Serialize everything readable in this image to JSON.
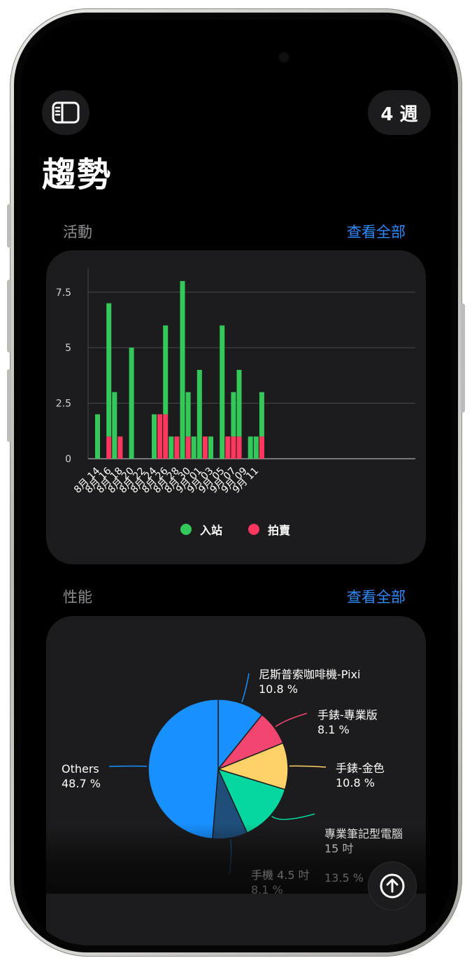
{
  "header": {
    "period_button": "4 週",
    "title": "趨勢"
  },
  "activity": {
    "section_label": "活動",
    "see_all": "查看全部",
    "legend": [
      {
        "name": "入站",
        "color": "#34c759"
      },
      {
        "name": "拍賣",
        "color": "#ff375f"
      }
    ]
  },
  "performance": {
    "section_label": "性能",
    "see_all": "查看全部"
  },
  "chart_data": [
    {
      "type": "bar",
      "ylim": [
        0,
        8.5
      ],
      "yticks": [
        0,
        2.5,
        5,
        7.5
      ],
      "ytick_labels": [
        "0",
        "2.5",
        "5",
        "7.5"
      ],
      "x_labels": [
        "8月 14",
        "8月 16",
        "8月 18",
        "8月 20",
        "8月 22",
        "8月 24",
        "8月 26",
        "8月 28",
        "8月 30",
        "9月 01",
        "9月 03",
        "9月 05",
        "9月 07",
        "9月 09",
        "9月 11"
      ],
      "grid": true,
      "legend": "bottom-center",
      "bars": [
        {
          "day": 0,
          "series": "入站",
          "value": 2
        },
        {
          "day": 2,
          "series": "入站",
          "value": 6,
          "stacked_on": {
            "series": "拍賣",
            "value": 1
          }
        },
        {
          "day": 3,
          "series": "入站",
          "value": 3
        },
        {
          "day": 4,
          "series": "拍賣",
          "value": 1
        },
        {
          "day": 6,
          "series": "入站",
          "value": 5
        },
        {
          "day": 10,
          "series": "入站",
          "value": 2
        },
        {
          "day": 11,
          "series": "拍賣",
          "value": 2
        },
        {
          "day": 12,
          "series": "入站",
          "value": 4,
          "stacked_on": {
            "series": "拍賣",
            "value": 2
          }
        },
        {
          "day": 13,
          "series": "入站",
          "value": 1
        },
        {
          "day": 14,
          "series": "拍賣",
          "value": 1
        },
        {
          "day": 15,
          "series": "入站",
          "value": 8
        },
        {
          "day": 16,
          "series": "入站",
          "value": 2,
          "stacked_on": {
            "series": "拍賣",
            "value": 1
          }
        },
        {
          "day": 17,
          "series": "入站",
          "value": 1
        },
        {
          "day": 18,
          "series": "入站",
          "value": 4
        },
        {
          "day": 19,
          "series": "拍賣",
          "value": 1
        },
        {
          "day": 20,
          "series": "入站",
          "value": 1
        },
        {
          "day": 22,
          "series": "入站",
          "value": 6
        },
        {
          "day": 23,
          "series": "拍賣",
          "value": 1
        },
        {
          "day": 24,
          "series": "入站",
          "value": 2,
          "stacked_on": {
            "series": "拍賣",
            "value": 1
          }
        },
        {
          "day": 25,
          "series": "入站",
          "value": 3,
          "stacked_on": {
            "series": "拍賣",
            "value": 1
          }
        },
        {
          "day": 27,
          "series": "入站",
          "value": 1
        },
        {
          "day": 28,
          "series": "入站",
          "value": 1
        },
        {
          "day": 29,
          "series": "入站",
          "value": 2,
          "stacked_on": {
            "series": "拍賣",
            "value": 1
          }
        }
      ]
    },
    {
      "type": "pie",
      "slices": [
        {
          "name": "尼斯普索咖啡機-Pixi",
          "value": 10.8,
          "label": "10.8 %",
          "color": "#1890ff"
        },
        {
          "name": "手錶-專業版",
          "value": 8.1,
          "label": "8.1 %",
          "color": "#f0456f"
        },
        {
          "name": "手錶-金色",
          "value": 10.8,
          "label": "10.8 %",
          "color": "#ffd166"
        },
        {
          "name": "專業筆記型電腦\n15 吋",
          "value": 13.5,
          "label": "13.5 %",
          "color": "#06d6a0"
        },
        {
          "name": "手機 4.5 吋",
          "value": 8.1,
          "label": "8.1 %",
          "color": "#1e4e7a"
        },
        {
          "name": "Others",
          "value": 48.7,
          "label": "48.7 %",
          "color": "#1890ff"
        }
      ]
    }
  ]
}
